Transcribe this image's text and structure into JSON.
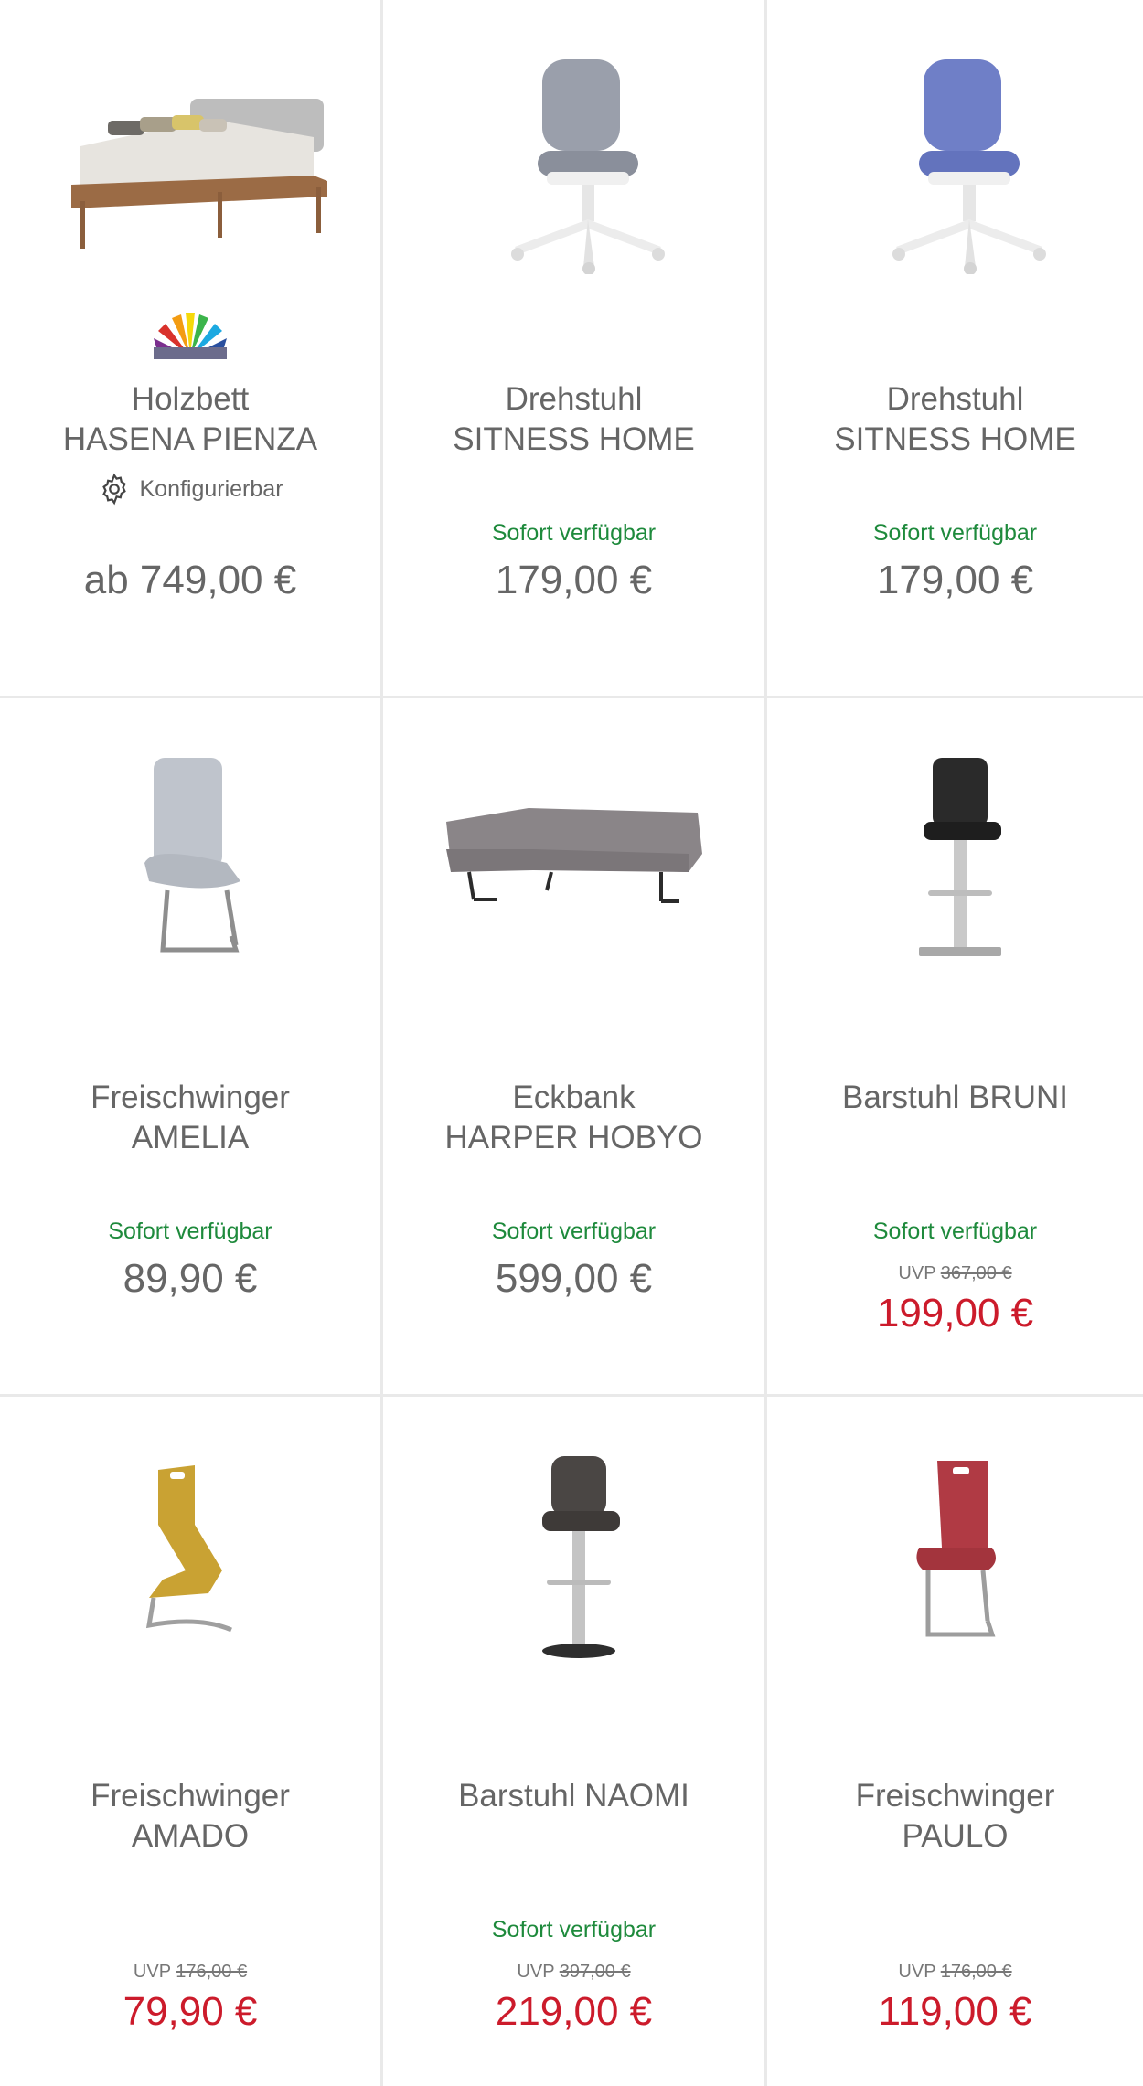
{
  "products": [
    {
      "title_line1": "Holzbett",
      "title_line2": "HASENA PIENZA",
      "config_label": "Konfigurierbar",
      "price": "ab 749,00 €",
      "image_icon": "bed-icon",
      "swatch_icon": "color-fan-icon"
    },
    {
      "title_line1": "Drehstuhl",
      "title_line2": "SITNESS HOME",
      "availability": "Sofort verfügbar",
      "price": "179,00 €",
      "image_icon": "office-chair-icon",
      "seat_color": "#9a9fab"
    },
    {
      "title_line1": "Drehstuhl",
      "title_line2": "SITNESS HOME",
      "availability": "Sofort verfügbar",
      "price": "179,00 €",
      "image_icon": "office-chair-icon",
      "seat_color": "#6f7fc7"
    },
    {
      "title_line1": "Freischwinger",
      "title_line2": "AMELIA",
      "availability": "Sofort verfügbar",
      "price": "89,90 €",
      "image_icon": "cantilever-chair-icon",
      "seat_color": "#bfc4cc"
    },
    {
      "title_line1": "Eckbank",
      "title_line2": "HARPER HOBYO",
      "availability": "Sofort verfügbar",
      "price": "599,00 €",
      "image_icon": "corner-bench-icon",
      "seat_color": "#8a8588"
    },
    {
      "title_line1": "Barstuhl BRUNI",
      "availability": "Sofort verfügbar",
      "uvp_label": "UVP",
      "uvp_old": "367,00 €",
      "price": "199,00 €",
      "image_icon": "bar-stool-icon",
      "seat_color": "#2a2a2a"
    },
    {
      "title_line1": "Freischwinger",
      "title_line2": "AMADO",
      "uvp_label": "UVP",
      "uvp_old": "176,00 €",
      "price": "79,90 €",
      "image_icon": "z-chair-icon",
      "seat_color": "#c9a233"
    },
    {
      "title_line1": "Barstuhl NAOMI",
      "availability": "Sofort verfügbar",
      "uvp_label": "UVP",
      "uvp_old": "397,00 €",
      "price": "219,00 €",
      "image_icon": "bar-stool-icon",
      "seat_color": "#4a4644"
    },
    {
      "title_line1": "Freischwinger",
      "title_line2": "PAULO",
      "uvp_label": "UVP",
      "uvp_old": "176,00 €",
      "price": "119,00 €",
      "image_icon": "cantilever-chair-icon",
      "seat_color": "#b03a44"
    }
  ],
  "colors": {
    "availability": "#1e8a3c",
    "sale_price": "#cc1b2b",
    "text": "#666666",
    "divider": "#e9e9e9"
  }
}
